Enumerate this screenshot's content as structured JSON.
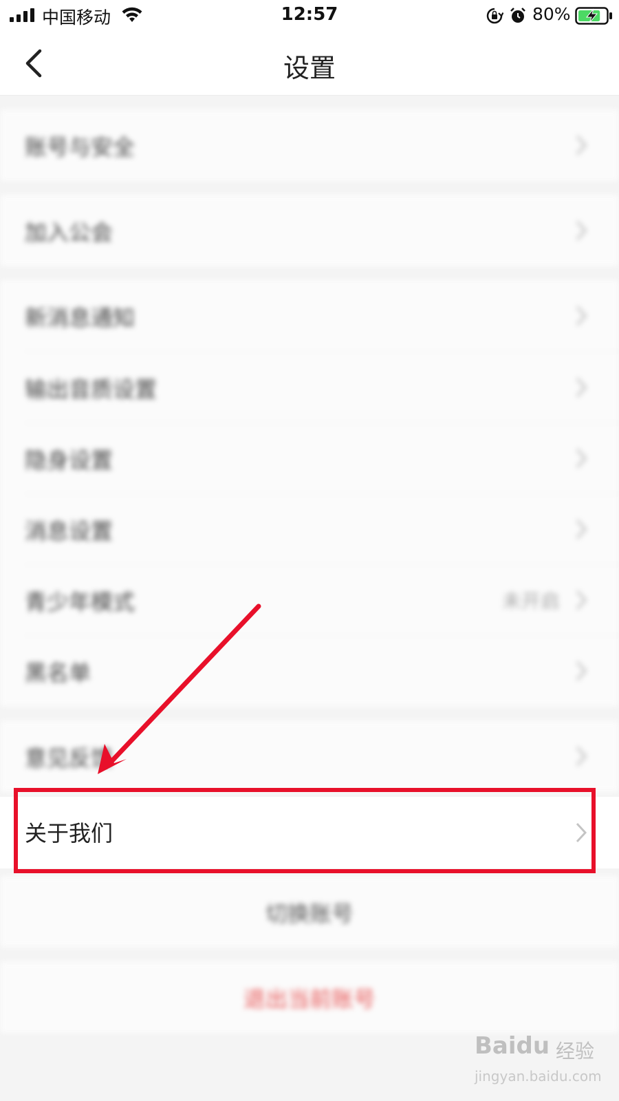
{
  "status_bar": {
    "carrier": "中国移动",
    "time": "12:57",
    "battery_percent": "80%",
    "battery_level": 0.8,
    "battery_color": "#4cd964",
    "icons": [
      "signal-icon",
      "wifi-icon",
      "orientation-lock-icon",
      "alarm-icon",
      "battery-charging-icon"
    ]
  },
  "navbar": {
    "title": "设置",
    "back_icon": "chevron-left-icon"
  },
  "groups": [
    {
      "items": [
        {
          "label": "账号与安全",
          "value": ""
        }
      ]
    },
    {
      "items": [
        {
          "label": "加入公会",
          "value": ""
        }
      ]
    },
    {
      "items": [
        {
          "label": "新消息通知",
          "value": ""
        },
        {
          "label": "输出音质设置",
          "value": ""
        },
        {
          "label": "隐身设置",
          "value": ""
        },
        {
          "label": "消息设置",
          "value": ""
        },
        {
          "label": "青少年模式",
          "value": "未开启"
        },
        {
          "label": "黑名单",
          "value": ""
        }
      ]
    },
    {
      "items": [
        {
          "label": "意见反馈",
          "value": ""
        }
      ]
    }
  ],
  "highlighted_item": {
    "label": "关于我们",
    "highlight_color": "#e8102a"
  },
  "actions": {
    "switch_account": "切换账号",
    "logout": "退出当前账号",
    "logout_color": "#e85a5a"
  },
  "watermark": {
    "brand": "Baidu",
    "service": "经验",
    "url": "jingyan.baidu.com"
  }
}
